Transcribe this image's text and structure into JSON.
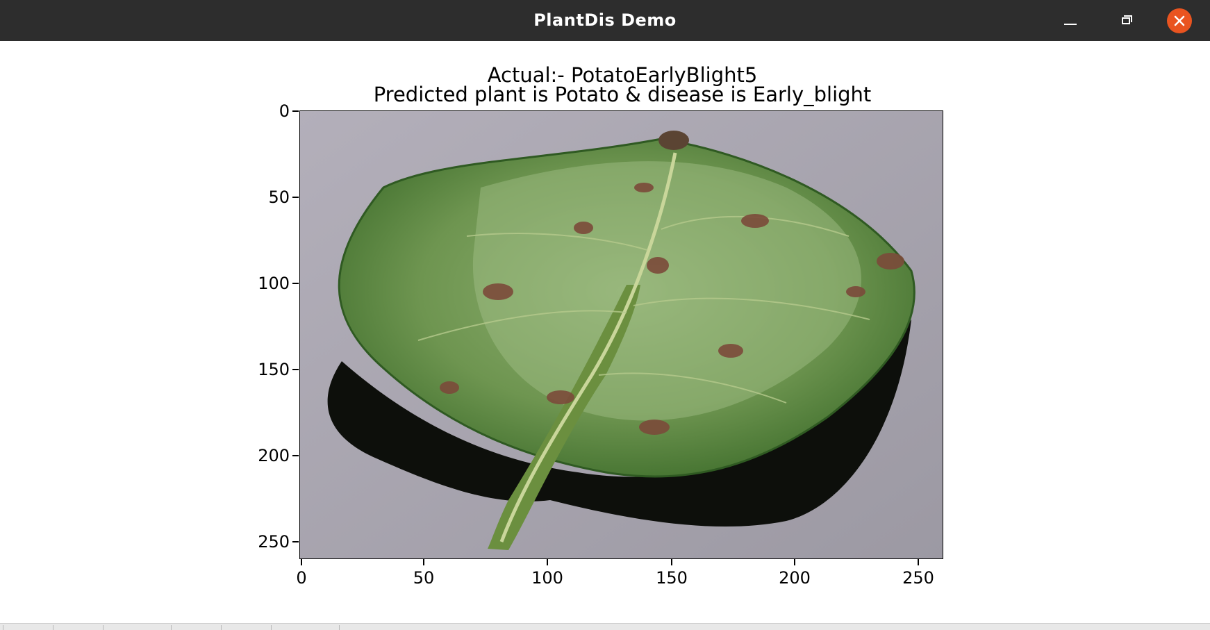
{
  "window": {
    "title": "PlantDis Demo",
    "minimize_icon": "minimize-icon",
    "maximize_icon": "restore-icon",
    "close_icon": "close-icon",
    "close_color": "#e95420"
  },
  "figure": {
    "title_line1": "Actual:- PotatoEarlyBlight5",
    "title_line2": "Predicted plant is Potato & disease is Early_blight",
    "image_content": "potato leaf with early blight lesions on gray background"
  },
  "axes": {
    "x_ticks": [
      "0",
      "50",
      "100",
      "150",
      "200",
      "250"
    ],
    "y_ticks": [
      "0",
      "50",
      "100",
      "150",
      "200",
      "250"
    ],
    "xlim": [
      0,
      256
    ],
    "ylim": [
      256,
      0
    ]
  },
  "toolbar": {
    "buttons": [
      "home",
      "back",
      "forward",
      "pan",
      "zoom",
      "subplots",
      "save"
    ]
  }
}
